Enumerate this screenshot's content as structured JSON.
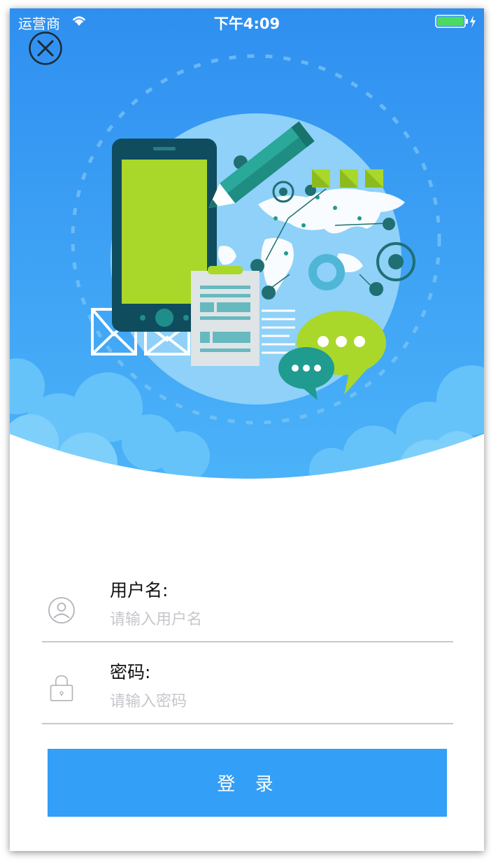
{
  "status_bar": {
    "carrier": "运营商",
    "time": "下午4:09",
    "icons": [
      "wifi-icon",
      "battery-icon",
      "charging-bolt-icon"
    ]
  },
  "header": {
    "close_icon": "close-circle-icon",
    "illustration_elements": [
      "phone",
      "pencil",
      "world-map-globe",
      "clipboard",
      "envelopes",
      "chat-bubbles",
      "clouds"
    ]
  },
  "form": {
    "username": {
      "label": "用户名:",
      "placeholder": "请输入用户名",
      "value": "",
      "icon": "user-icon"
    },
    "password": {
      "label": "密码:",
      "placeholder": "请输入密码",
      "value": "",
      "icon": "lock-icon"
    },
    "login_button": "登 录"
  },
  "colors": {
    "sky_top": "#2f8ff0",
    "sky_bottom": "#4ab1f8",
    "globe": "#8fd1f8",
    "phone_screen": "#a9d82a",
    "phone_body": "#0f4d5e",
    "accent_teal": "#1f9b8f",
    "button": "#339ff7",
    "divider": "#c8c8c8",
    "placeholder": "#c6c6cc"
  }
}
